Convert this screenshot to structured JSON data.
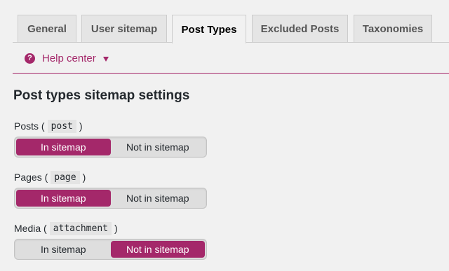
{
  "tabs": [
    {
      "label": "General",
      "active": false
    },
    {
      "label": "User sitemap",
      "active": false
    },
    {
      "label": "Post Types",
      "active": true
    },
    {
      "label": "Excluded Posts",
      "active": false
    },
    {
      "label": "Taxonomies",
      "active": false
    }
  ],
  "help": {
    "label": "Help center",
    "icon": "question-circle-icon",
    "caret": "caret-down-icon"
  },
  "heading": "Post types sitemap settings",
  "settings": [
    {
      "label": "Posts",
      "code": "post",
      "options": [
        "In sitemap",
        "Not in sitemap"
      ],
      "selected": "In sitemap"
    },
    {
      "label": "Pages",
      "code": "page",
      "options": [
        "In sitemap",
        "Not in sitemap"
      ],
      "selected": "In sitemap"
    },
    {
      "label": "Media",
      "code": "attachment",
      "options": [
        "In sitemap",
        "Not in sitemap"
      ],
      "selected": "Not in sitemap"
    }
  ],
  "colors": {
    "accent": "#a4286a",
    "background": "#f1f1f1",
    "tab_inactive": "#e5e5e5"
  }
}
